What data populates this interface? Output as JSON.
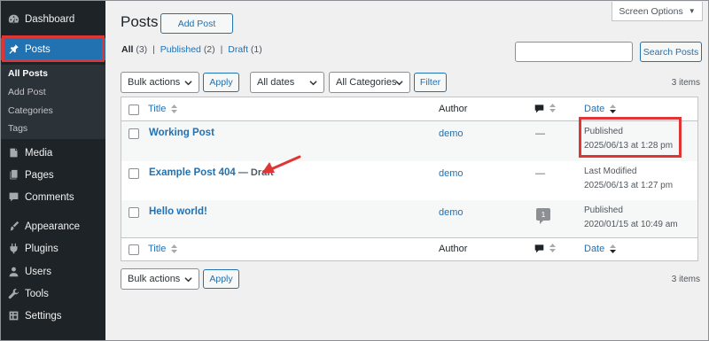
{
  "sidebar": {
    "dashboard": "Dashboard",
    "posts": "Posts",
    "submenu": [
      "All Posts",
      "Add Post",
      "Categories",
      "Tags"
    ],
    "media": "Media",
    "pages": "Pages",
    "comments": "Comments",
    "appearance": "Appearance",
    "plugins": "Plugins",
    "users": "Users",
    "tools": "Tools",
    "settings": "Settings"
  },
  "header": {
    "title": "Posts",
    "add_post": "Add Post",
    "screen_options": "Screen Options"
  },
  "filters": {
    "all_label": "All",
    "all_count": "(3)",
    "published_label": "Published",
    "published_count": "(2)",
    "draft_label": "Draft",
    "draft_count": "(1)",
    "separator": "|",
    "search_button": "Search Posts",
    "bulk_actions": "Bulk actions",
    "apply": "Apply",
    "all_dates": "All dates",
    "all_categories": "All Categories",
    "filter": "Filter",
    "items_count": "3 items"
  },
  "table": {
    "columns": {
      "title": "Title",
      "author": "Author",
      "date": "Date"
    },
    "rows": [
      {
        "title": "Working Post",
        "state": "",
        "author": "demo",
        "comments": "—",
        "status": "Published",
        "date": "2025/06/13 at 1:28 pm"
      },
      {
        "title": "Example Post 404",
        "state": "— Draft",
        "author": "demo",
        "comments": "—",
        "status": "Last Modified",
        "date": "2025/06/13 at 1:27 pm"
      },
      {
        "title": "Hello world!",
        "state": "",
        "author": "demo",
        "comments": "1",
        "status": "Published",
        "date": "2020/01/15 at 10:49 am"
      }
    ]
  },
  "colors": {
    "accent": "#2271b1",
    "sidebar": "#1d2327",
    "highlight": "#e03535"
  }
}
